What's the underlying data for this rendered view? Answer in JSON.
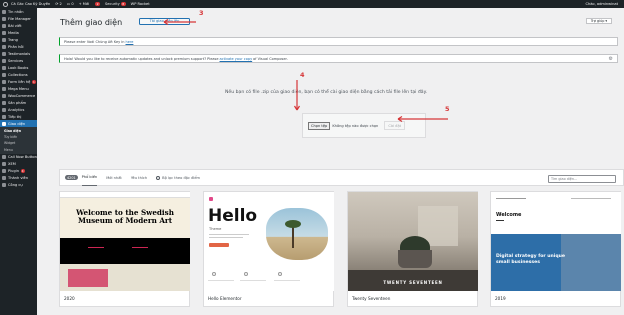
{
  "adminbar": {
    "site": "Cà Gác Cao Kỹ Duyên",
    "comments": "2",
    "updates": "0",
    "new": "+ Mới",
    "new_badge": "2",
    "security": "Security",
    "security_badge": "8",
    "rocket": "WP Rocket",
    "greeting": "Chào, adminwinat"
  },
  "sidebar": {
    "items": [
      {
        "label": "Tin nhắn"
      },
      {
        "label": "File Manager"
      },
      {
        "label": "Bài viết"
      },
      {
        "label": "Media"
      },
      {
        "label": "Trang"
      },
      {
        "label": "Phản hồi"
      },
      {
        "label": "Testimonials"
      },
      {
        "label": "Services"
      },
      {
        "label": "Look Books"
      },
      {
        "label": "Collections"
      },
      {
        "label": "Form liên hệ",
        "badge": "1"
      },
      {
        "label": "Mega Menu"
      },
      {
        "label": "WooCommerce"
      },
      {
        "label": "Sản phẩm"
      },
      {
        "label": "Analytics"
      },
      {
        "label": "Tiếp thị"
      },
      {
        "label": "Giao diện"
      }
    ],
    "submenu": [
      "Giao diện",
      "Tùy biến",
      "Widget",
      "Menu"
    ],
    "after": [
      {
        "label": "Call Now Button"
      },
      {
        "label": "XEM"
      },
      {
        "label": "Plugin",
        "badge": "4"
      },
      {
        "label": "Thành viên"
      },
      {
        "label": "Công cụ"
      }
    ]
  },
  "page": {
    "title": "Thêm giao diện",
    "upload_button": "Tải giao diện lên",
    "help": "Trợ giúp ▾"
  },
  "notice1": {
    "text": "Please enter Vodi Chùng Aft Key in",
    "link": "here"
  },
  "notice2": {
    "text": "Hola! Would you like to receive automatic updates and unlock premium support? Please",
    "link": "activate your copy",
    "text2": "of Visual Composer."
  },
  "upload": {
    "message": "Nếu bạn có file .zip của giao diện, bạn có thể cài giao diện bằng cách tải file lên tại đây.",
    "choose_file": "Chọn tệp",
    "no_file": "Không tệp nào được chọn",
    "install": "Cài đặt"
  },
  "filter": {
    "count": "4201",
    "tabs": [
      "Phổ biến",
      "Mới nhất",
      "Yêu thích"
    ],
    "feature_filter": "Bộ lọc theo đặc điểm",
    "search_placeholder": "Tìm giao diện..."
  },
  "themes": [
    {
      "name": "2020",
      "heading": "Welcome to the Swedish Museum of Modern Art"
    },
    {
      "name": "Hello Elementor",
      "heading": "Hello",
      "sub": "Theme"
    },
    {
      "name": "Twenty Seventeen",
      "heading": "TWENTY SEVENTEEN"
    },
    {
      "name": "2019",
      "heading": "Welcome",
      "sub": "Digital strategy for unique small businesses"
    }
  ],
  "annotations": {
    "a3": "3",
    "a4": "4",
    "a5": "5"
  },
  "colors": {
    "adminbar": "#1d2327",
    "accent": "#2271b1",
    "annotation": "#d63638",
    "notice_border": "#00a32a"
  }
}
